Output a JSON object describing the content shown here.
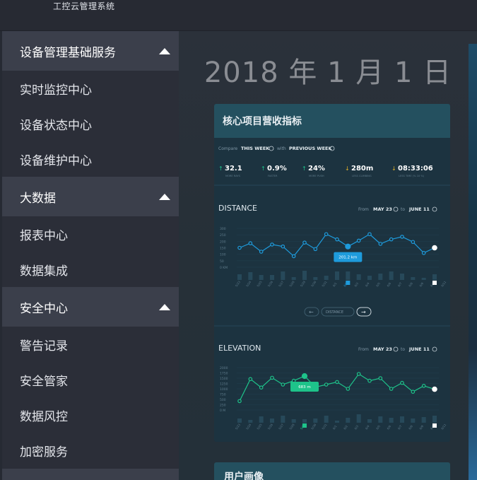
{
  "app": {
    "title": "工控云管理系统"
  },
  "sidebar": {
    "groups": [
      {
        "title": "设备管理基础服务",
        "items": [
          "实时监控中心",
          "设备状态中心",
          "设备维护中心"
        ]
      },
      {
        "title": "大数据",
        "items": [
          "报表中心",
          "数据集成"
        ]
      },
      {
        "title": "安全中心",
        "items": [
          "警告记录",
          "安全管家",
          "数据风控",
          "加密服务"
        ]
      }
    ]
  },
  "main": {
    "date": "2018 年 1 月 1 日",
    "card": {
      "title": "核心项目营收指标",
      "compare": {
        "label": "Compare",
        "this_week": "THIS WEEK",
        "with": "with",
        "prev_week": "PREVIOUS WEEK"
      },
      "stats": [
        {
          "value": "32.1",
          "label": "MORE RAYS",
          "dir": "up"
        },
        {
          "value": "0.9%",
          "label": "FASTER",
          "dir": "up"
        },
        {
          "value": "24%",
          "label": "MORE PUSH",
          "dir": "up"
        },
        {
          "value": "280m",
          "label": "LESS CLIMBING",
          "dir": "down"
        },
        {
          "value": "08:33:06",
          "label": "LESS TIME (% 10 %)",
          "dir": "down"
        }
      ],
      "distance": {
        "title": "DISTANCE",
        "from_label": "From",
        "from": "MAY 23",
        "to_label": "to",
        "to": "JUNE 11",
        "y_ticks": [
          "300",
          "250",
          "200",
          "150",
          "100",
          "50",
          "0 KM"
        ],
        "tooltip": "201.2 km",
        "nav_select": "DISTANCE"
      },
      "elevation": {
        "title": "ELEVATION",
        "from_label": "From",
        "from": "MAY 23",
        "to_label": "to",
        "to": "JUNE 11",
        "y_ticks": [
          "2000",
          "1750",
          "1500",
          "1250",
          "1000",
          "750",
          "500",
          "250",
          "0 M"
        ],
        "tooltip": "683 m"
      }
    },
    "card2": {
      "title": "用户画像"
    }
  },
  "chart_data": [
    {
      "type": "line",
      "title": "DISTANCE",
      "ylabel": "KM",
      "ylim": [
        0,
        300
      ],
      "x": [
        "5/23",
        "5/24",
        "5/25",
        "5/26",
        "5/27",
        "5/28",
        "5/29",
        "5/30",
        "5/31",
        "6/1",
        "6/2",
        "6/3",
        "6/4",
        "6/5",
        "6/6",
        "6/7",
        "6/8",
        "6/9",
        "6/10",
        "6/11"
      ],
      "values": [
        150,
        185,
        120,
        175,
        160,
        85,
        190,
        140,
        255,
        215,
        160,
        205,
        255,
        180,
        215,
        235,
        195,
        110,
        150
      ],
      "highlight": {
        "index": 10,
        "label": "201.2 km"
      },
      "color": "#1e9bdc"
    },
    {
      "type": "line",
      "title": "ELEVATION",
      "ylabel": "M",
      "ylim": [
        0,
        2000
      ],
      "x": [
        "5/23",
        "5/24",
        "5/25",
        "5/26",
        "5/27",
        "5/28",
        "5/29",
        "5/30",
        "5/31",
        "6/1",
        "6/2",
        "6/3",
        "6/4",
        "6/5",
        "6/6",
        "6/7",
        "6/8",
        "6/9",
        "6/10",
        "6/11"
      ],
      "values": [
        420,
        1460,
        1060,
        1520,
        1200,
        1380,
        1600,
        1080,
        1200,
        1320,
        1000,
        1700,
        1380,
        1500,
        1000,
        1280,
        860,
        1140,
        980
      ],
      "highlight": {
        "index": 6,
        "label": "683 m"
      },
      "color": "#1ec38a"
    }
  ]
}
